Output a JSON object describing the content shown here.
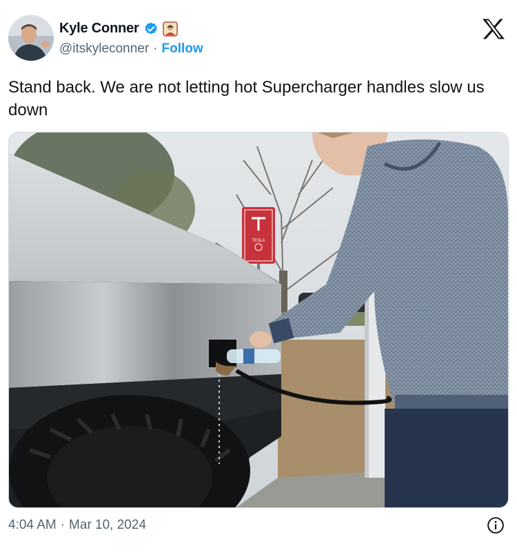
{
  "author": {
    "display_name": "Kyle Conner",
    "handle": "@itskyleconner",
    "separator": "·",
    "follow_label": "Follow",
    "verified_color": "#1d9bf0"
  },
  "tweet": {
    "text": "Stand back. We are not letting hot Supercharger handles slow us down"
  },
  "media": {
    "sign_brand": "TESLA"
  },
  "footer": {
    "time": "4:04 AM",
    "separator": "·",
    "date": "Mar 10, 2024"
  },
  "icons": {
    "platform": "x-logo-icon",
    "verified": "verified-badge-icon",
    "info": "info-icon"
  }
}
